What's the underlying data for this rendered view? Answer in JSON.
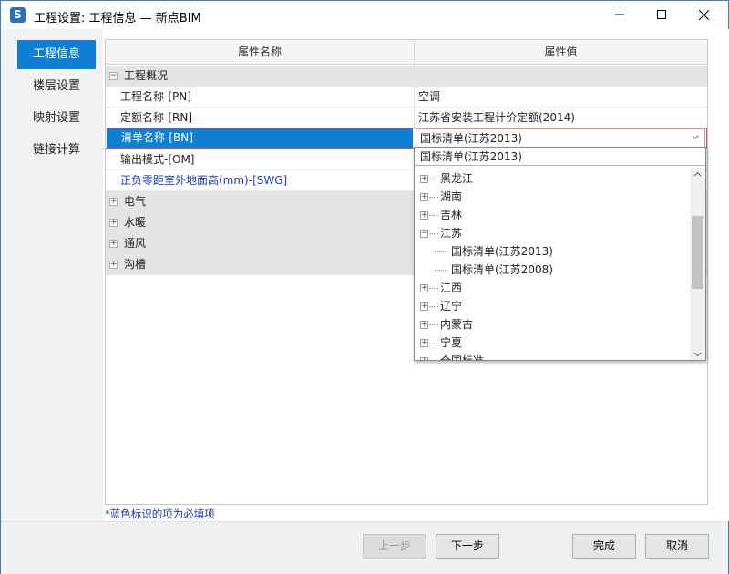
{
  "window": {
    "title": "工程设置: 工程信息 — 新点BIM",
    "icon": "app-logo-icon"
  },
  "sidebar": {
    "items": [
      {
        "label": "工程信息",
        "active": true
      },
      {
        "label": "楼层设置",
        "active": false
      },
      {
        "label": "映射设置",
        "active": false
      },
      {
        "label": "链接计算",
        "active": false
      }
    ]
  },
  "grid": {
    "headers": {
      "name": "属性名称",
      "value": "属性值"
    },
    "rows": [
      {
        "type": "group",
        "expander": "−",
        "name": "工程概况",
        "value": ""
      },
      {
        "type": "normal",
        "name": "工程名称-[PN]",
        "value": "空调"
      },
      {
        "type": "normal",
        "name": "定额名称-[RN]",
        "value": "江苏省安装工程计价定额(2014)"
      },
      {
        "type": "selected",
        "name": "清单名称-[BN]",
        "value": "国标清单(江苏2013)"
      },
      {
        "type": "normal",
        "name": "输出模式-[OM]",
        "value": ""
      },
      {
        "type": "required",
        "name": "正负零距室外地面高(mm)-[SWG]",
        "value": ""
      },
      {
        "type": "group",
        "expander": "+",
        "name": "电气",
        "value": ""
      },
      {
        "type": "group",
        "expander": "+",
        "name": "水暖",
        "value": ""
      },
      {
        "type": "group",
        "expander": "+",
        "name": "通风",
        "value": ""
      },
      {
        "type": "group",
        "expander": "+",
        "name": "沟槽",
        "value": ""
      }
    ]
  },
  "dropdown": {
    "current": "国标清单(江苏2013)",
    "tree": [
      {
        "label": "黑龙江",
        "level": 0,
        "expander": "+"
      },
      {
        "label": "湖南",
        "level": 0,
        "expander": "+"
      },
      {
        "label": "吉林",
        "level": 0,
        "expander": "+"
      },
      {
        "label": "江苏",
        "level": 0,
        "expander": "−"
      },
      {
        "label": "国标清单(江苏2013)",
        "level": 1,
        "expander": ""
      },
      {
        "label": "国标清单(江苏2008)",
        "level": 1,
        "expander": ""
      },
      {
        "label": "江西",
        "level": 0,
        "expander": "+"
      },
      {
        "label": "辽宁",
        "level": 0,
        "expander": "+"
      },
      {
        "label": "内蒙古",
        "level": 0,
        "expander": "+"
      },
      {
        "label": "宁夏",
        "level": 0,
        "expander": "+"
      },
      {
        "label": "全国标准",
        "level": 0,
        "expander": "+"
      }
    ]
  },
  "note": "*蓝色标识的项为必填项",
  "footer": {
    "prev": "上一步",
    "next": "下一步",
    "finish": "完成",
    "cancel": "取消"
  },
  "colors": {
    "accent": "#0f7fd3",
    "required_text": "#1a3ccc",
    "selected_border": "#e05050"
  }
}
